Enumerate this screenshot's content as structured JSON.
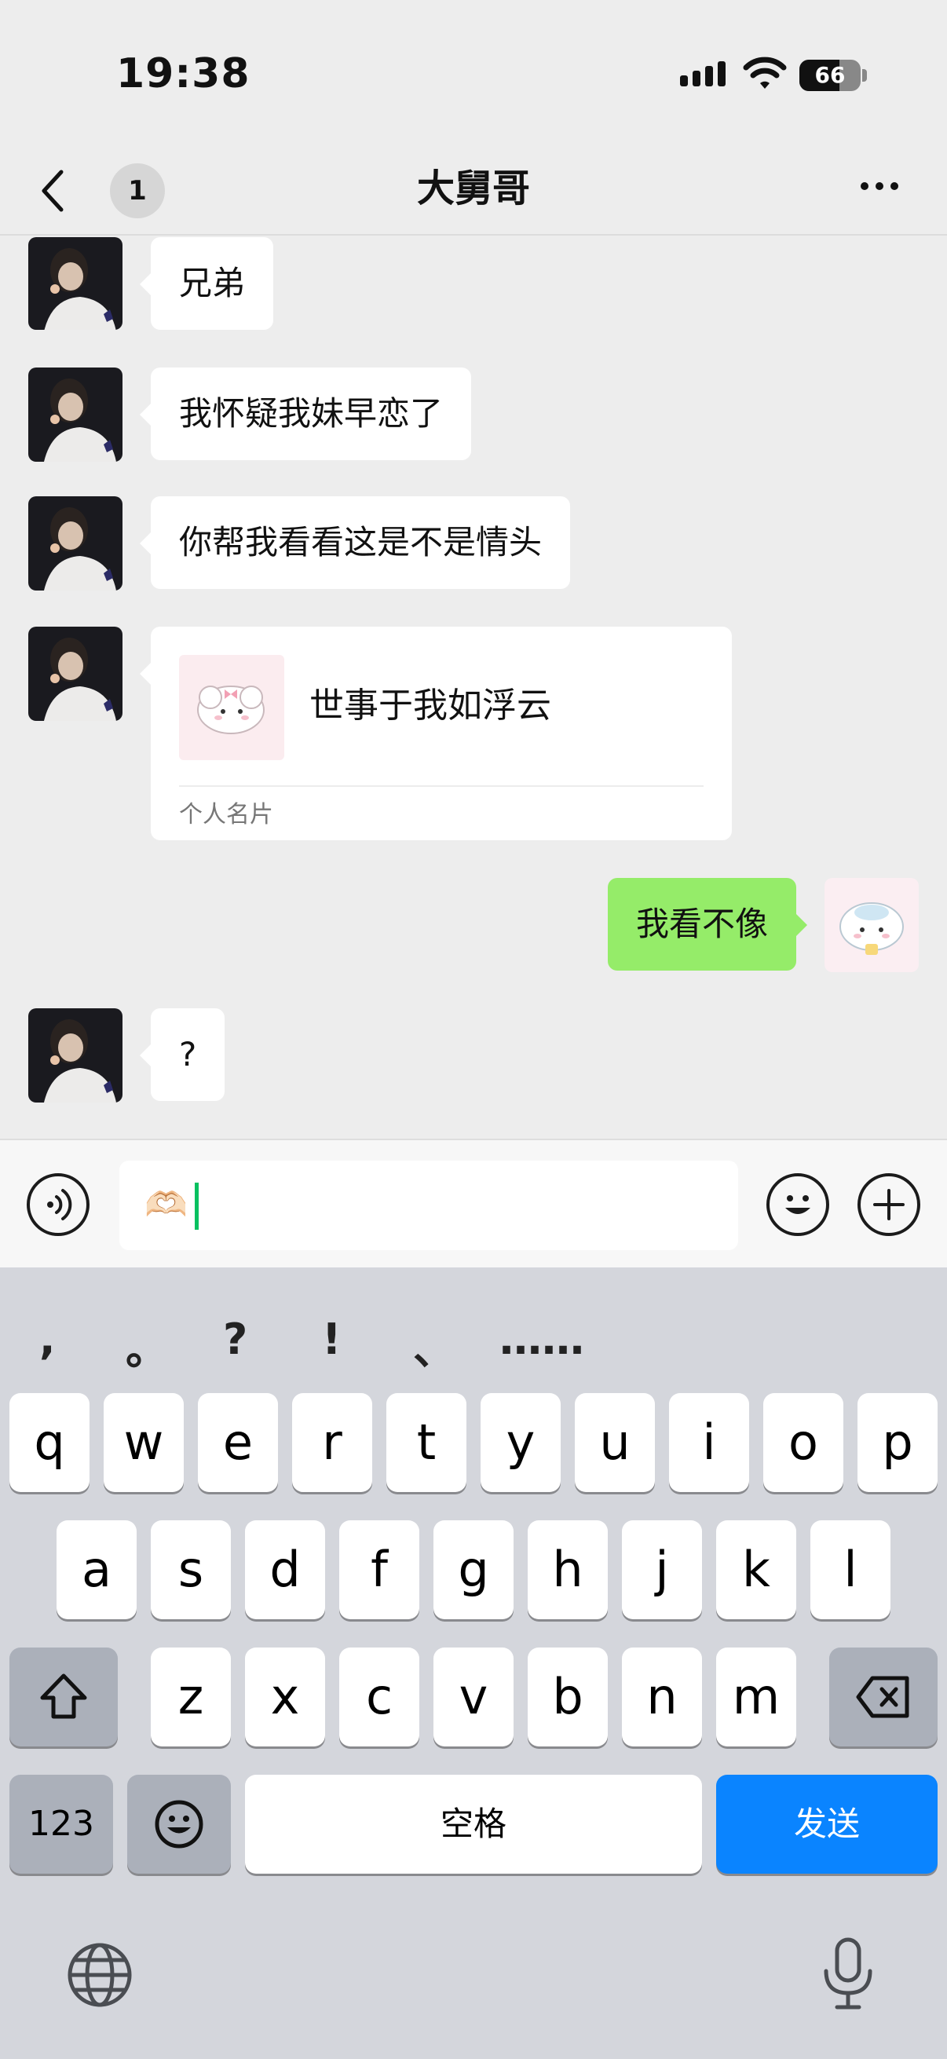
{
  "status_bar": {
    "time": "19:38",
    "battery_level": "66",
    "battery_fraction": 0.66
  },
  "nav": {
    "unread_count": "1",
    "title": "大舅哥"
  },
  "messages": [
    {
      "side": "incoming",
      "type": "text",
      "text": "兄弟"
    },
    {
      "side": "incoming",
      "type": "text",
      "text": "我怀疑我妹早恋了"
    },
    {
      "side": "incoming",
      "type": "text",
      "text": "你帮我看看这是不是情头"
    },
    {
      "side": "incoming",
      "type": "contact_card",
      "name": "世事于我如浮云",
      "card_type": "个人名片"
    },
    {
      "side": "outgoing",
      "type": "text",
      "text": "我看不像"
    },
    {
      "side": "incoming",
      "type": "text",
      "text": "?"
    }
  ],
  "input": {
    "value": "🫶🏻"
  },
  "keyboard": {
    "punctuation": [
      ",",
      "。",
      "?",
      "!",
      "、",
      "……"
    ],
    "row1": [
      "q",
      "w",
      "e",
      "r",
      "t",
      "y",
      "u",
      "i",
      "o",
      "p"
    ],
    "row2": [
      "a",
      "s",
      "d",
      "f",
      "g",
      "h",
      "j",
      "k",
      "l"
    ],
    "row3": [
      "z",
      "x",
      "c",
      "v",
      "b",
      "n",
      "m"
    ],
    "numbers_label": "123",
    "space_label": "空格",
    "send_label": "发送"
  },
  "colors": {
    "outgoing_bubble": "#95ec69",
    "send_key": "#0a84ff",
    "caret": "#07c160"
  }
}
